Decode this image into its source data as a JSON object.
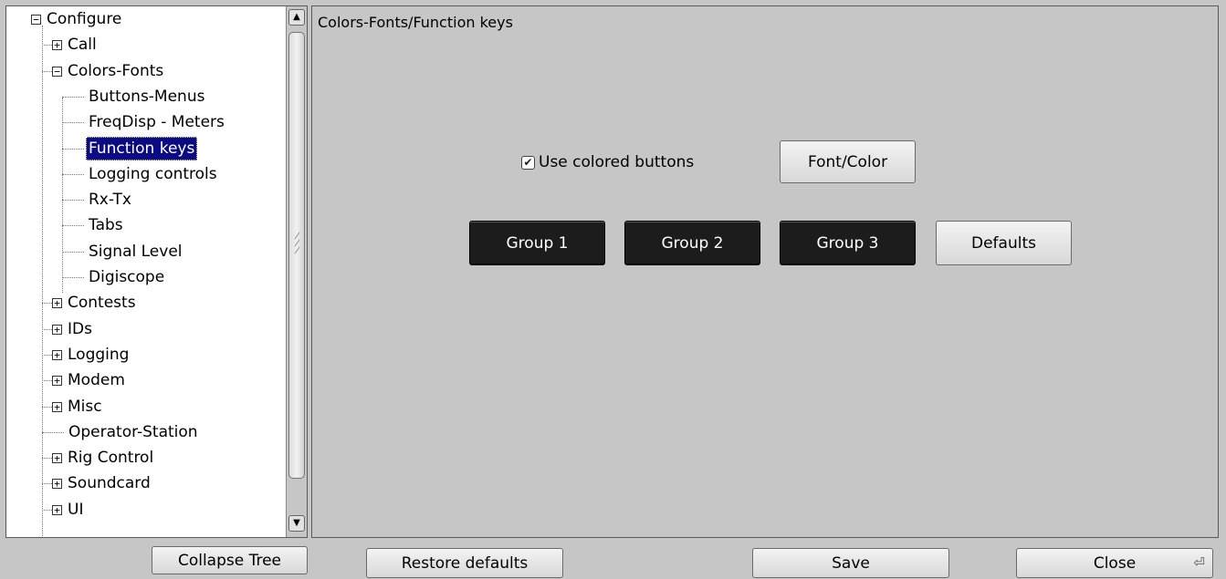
{
  "tree": {
    "items": [
      {
        "label": "Configure",
        "expander": "−",
        "selected": false
      },
      {
        "label": "Call",
        "expander": "+",
        "selected": false
      },
      {
        "label": "Colors-Fonts",
        "expander": "−",
        "selected": false
      },
      {
        "label": "Buttons-Menus",
        "expander": "",
        "selected": false
      },
      {
        "label": "FreqDisp - Meters",
        "expander": "",
        "selected": false
      },
      {
        "label": "Function keys",
        "expander": "",
        "selected": true
      },
      {
        "label": "Logging controls",
        "expander": "",
        "selected": false
      },
      {
        "label": "Rx-Tx",
        "expander": "",
        "selected": false
      },
      {
        "label": "Tabs",
        "expander": "",
        "selected": false
      },
      {
        "label": "Signal Level",
        "expander": "",
        "selected": false
      },
      {
        "label": "Digiscope",
        "expander": "",
        "selected": false
      },
      {
        "label": "Contests",
        "expander": "+",
        "selected": false
      },
      {
        "label": "IDs",
        "expander": "+",
        "selected": false
      },
      {
        "label": "Logging",
        "expander": "+",
        "selected": false
      },
      {
        "label": "Modem",
        "expander": "+",
        "selected": false
      },
      {
        "label": "Misc",
        "expander": "+",
        "selected": false
      },
      {
        "label": "Operator-Station",
        "expander": "",
        "selected": false
      },
      {
        "label": "Rig Control",
        "expander": "+",
        "selected": false
      },
      {
        "label": "Soundcard",
        "expander": "+",
        "selected": false
      },
      {
        "label": "UI",
        "expander": "+",
        "selected": false
      }
    ],
    "scroll_up_icon": "▲",
    "scroll_down_icon": "▼"
  },
  "panel": {
    "title": "Colors-Fonts/Function keys",
    "use_colored_label": "Use colored buttons",
    "use_colored_checked": "✔",
    "font_color_label": "Font/Color",
    "group1_label": "Group 1",
    "group2_label": "Group 2",
    "group3_label": "Group 3",
    "defaults_label": "Defaults"
  },
  "footer": {
    "collapse_label": "Collapse Tree",
    "restore_label": "Restore defaults",
    "save_label": "Save",
    "close_label": "Close",
    "close_icon": "⏎"
  },
  "colors": {
    "selection": "#0a0a82",
    "group_button_bg": "#1c1c1c",
    "panel_bg": "#c6c6c6"
  }
}
